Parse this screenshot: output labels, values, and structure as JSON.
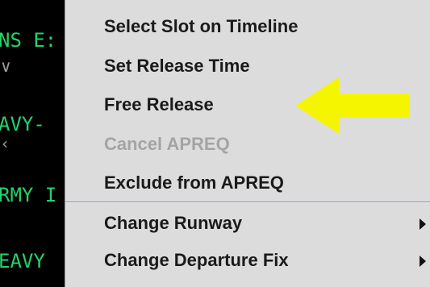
{
  "background": {
    "labels": [
      "NS E:",
      "AVY-",
      "RMY I",
      "EAVY"
    ],
    "marks": [
      "∨",
      "‹"
    ]
  },
  "menu": {
    "items": [
      {
        "label": "Select Slot on Timeline",
        "enabled": true,
        "submenu": false
      },
      {
        "label": "Set Release Time",
        "enabled": true,
        "submenu": false
      },
      {
        "label": "Free Release",
        "enabled": true,
        "submenu": false
      },
      {
        "label": "Cancel APREQ",
        "enabled": false,
        "submenu": false
      },
      {
        "label": "Exclude from APREQ",
        "enabled": true,
        "submenu": false
      },
      {
        "label": "Change Runway",
        "enabled": true,
        "submenu": true
      },
      {
        "label": "Change Departure Fix",
        "enabled": true,
        "submenu": true
      }
    ]
  },
  "annotation": {
    "icon": "arrow-left-icon",
    "color": "#f5f500",
    "points_to": "Free Release"
  },
  "colors": {
    "menu_background": "#dcdcdc",
    "menu_text": "#1a1a1a",
    "disabled_text": "#a4a4a4",
    "display_background": "#000000",
    "display_text": "#22d36b"
  }
}
